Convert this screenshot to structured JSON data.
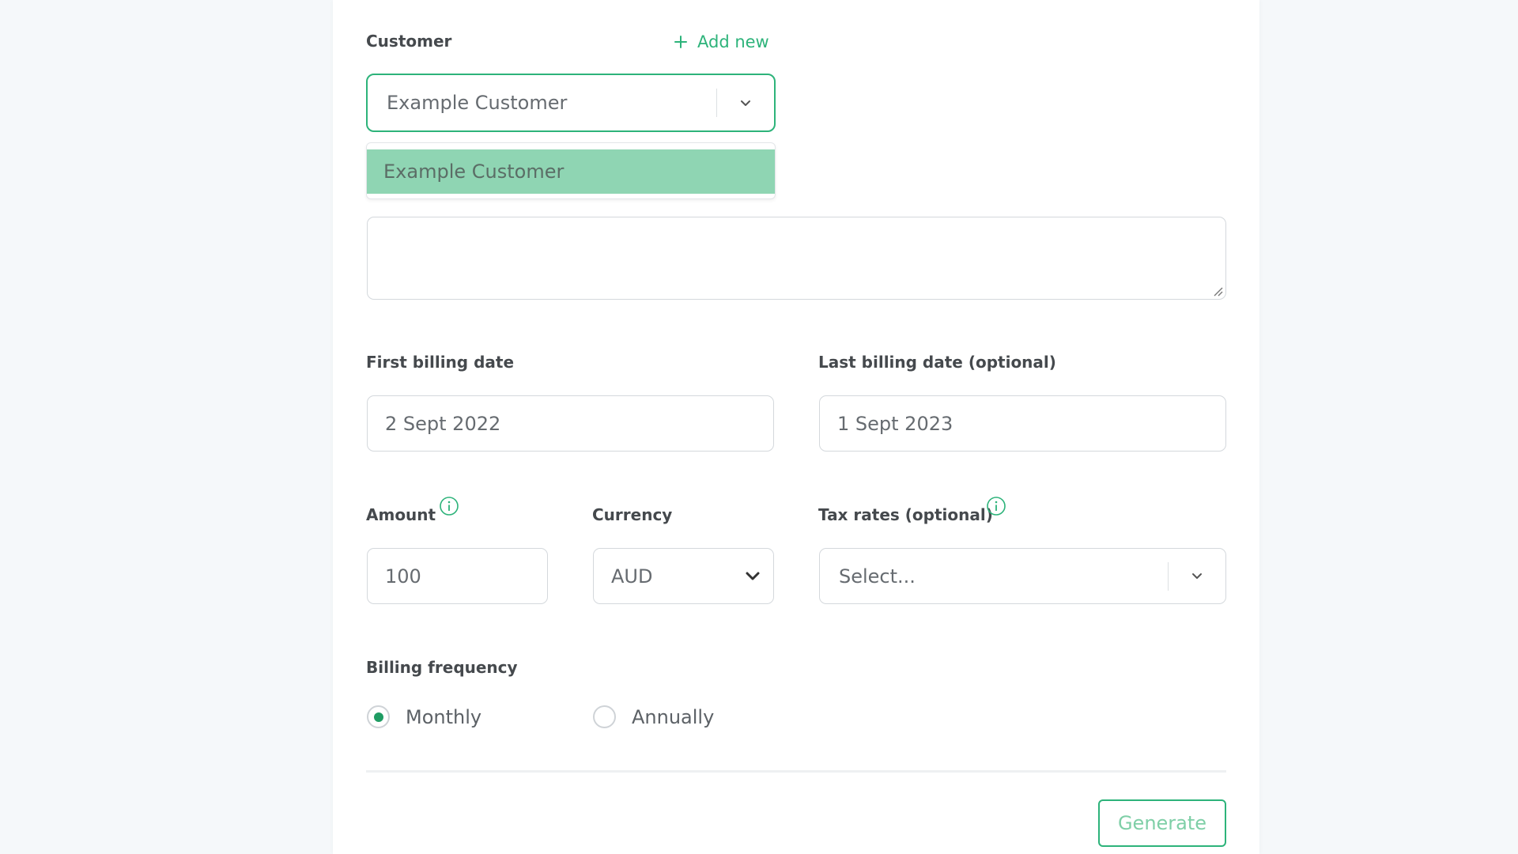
{
  "customer": {
    "label": "Customer",
    "add_new": "Add new",
    "selected": "Example Customer",
    "options": [
      "Example Customer"
    ]
  },
  "description": {
    "value": ""
  },
  "first_billing_date": {
    "label": "First billing date",
    "value": "2 Sept 2022"
  },
  "last_billing_date": {
    "label": "Last billing date (optional)",
    "value": "1 Sept 2023"
  },
  "amount": {
    "label": "Amount",
    "value": "100"
  },
  "currency": {
    "label": "Currency",
    "value": "AUD"
  },
  "tax_rates": {
    "label": "Tax rates (optional)",
    "placeholder": "Select..."
  },
  "billing_frequency": {
    "label": "Billing frequency",
    "options": [
      {
        "label": "Monthly",
        "selected": true
      },
      {
        "label": "Annually",
        "selected": false
      }
    ]
  },
  "actions": {
    "generate": "Generate"
  },
  "colors": {
    "accent": "#2db37a",
    "option_highlight": "#8fd5b3"
  },
  "icons": [
    "plus-icon",
    "chevron-down-icon",
    "info-icon",
    "resize-handle-icon"
  ]
}
